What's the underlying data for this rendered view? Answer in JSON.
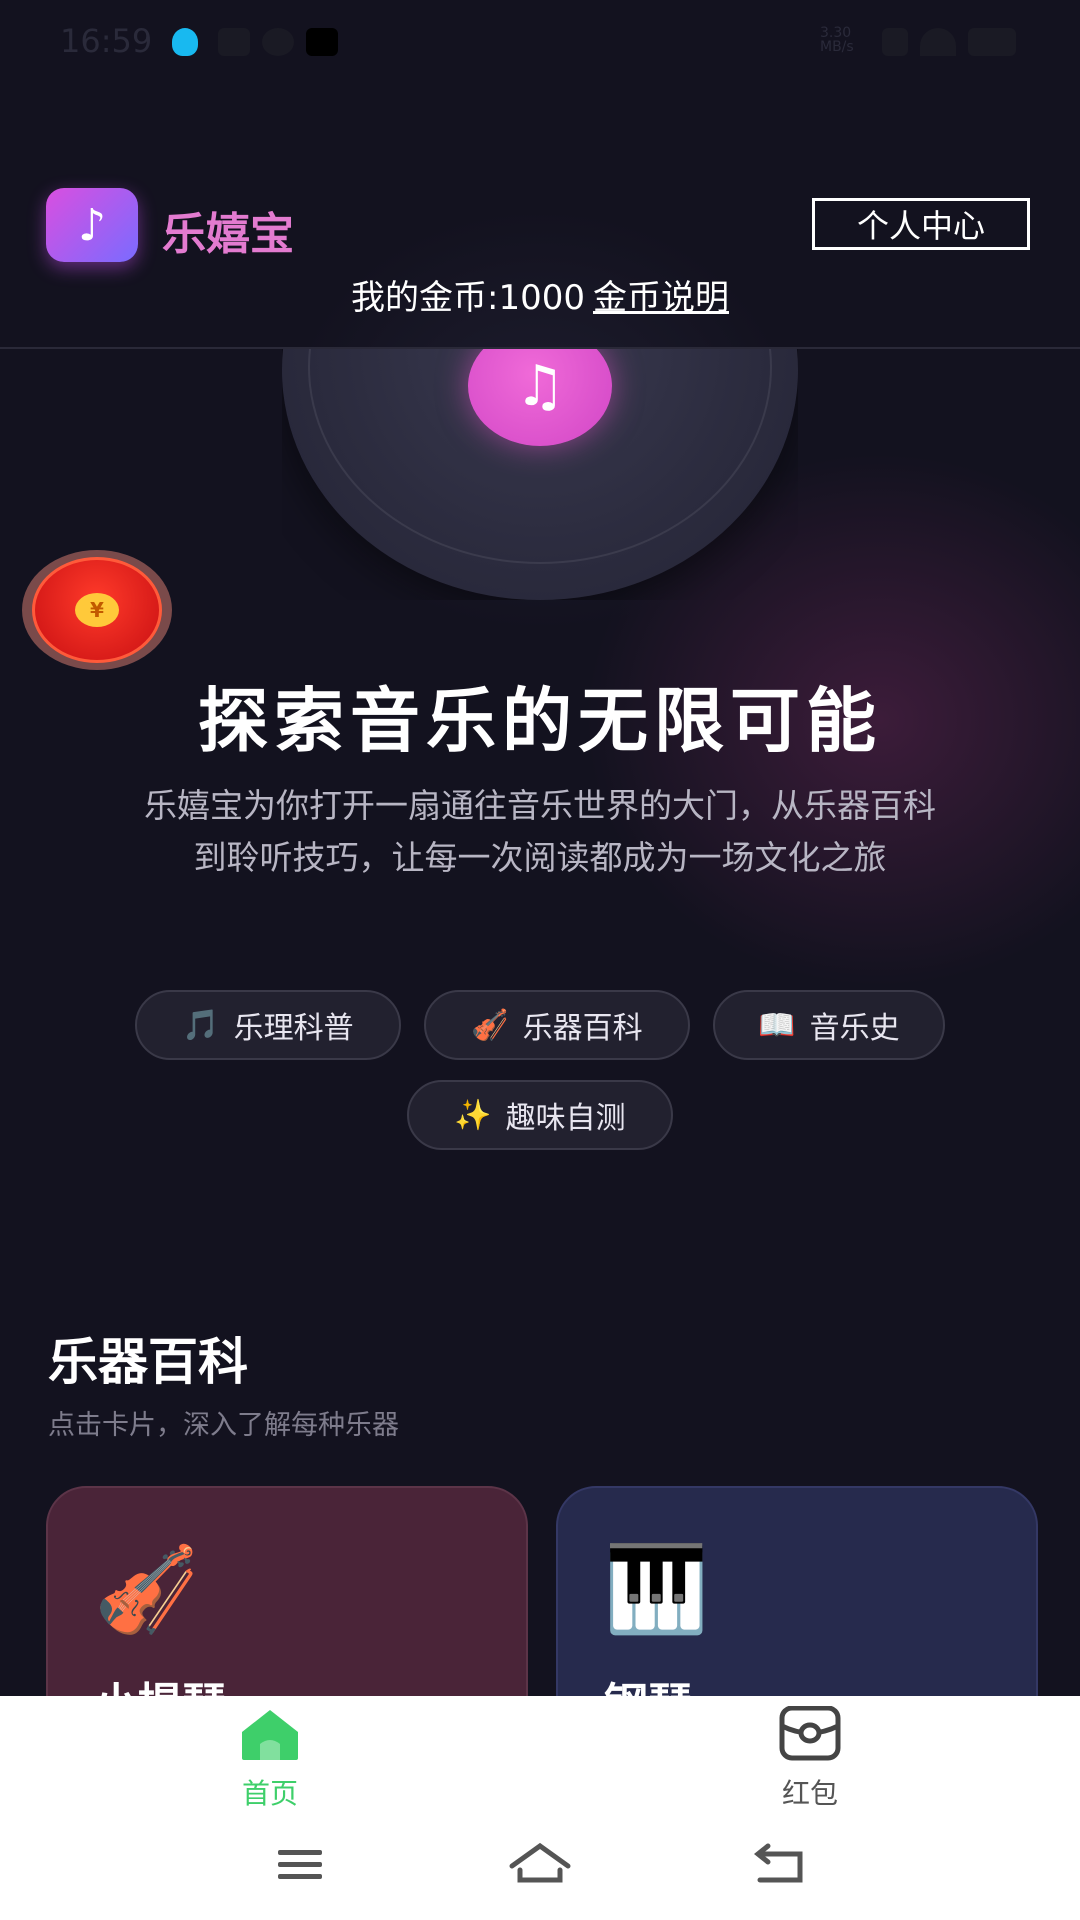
{
  "status_bar": {
    "time": "16:59",
    "speed": "3.30 MB/s",
    "icons": [
      "qq-icon",
      "mail-icon",
      "link-icon",
      "tiktok-icon"
    ]
  },
  "header": {
    "logo_icon": "music-note-icon",
    "app_name": "乐嬉宝",
    "profile_button": "个人中心",
    "coins_text": "我的金币:1000",
    "coins_link": "金币说明"
  },
  "hero": {
    "title": "探索音乐的无限可能",
    "description": "乐嬉宝为你打开一扇通往音乐世界的大门，从乐器百科到聆听技巧，让每一次阅读都成为一场文化之旅",
    "chips": [
      {
        "icon": "🎵",
        "label": "乐理科普"
      },
      {
        "icon": "🎻",
        "label": "乐器百科"
      },
      {
        "icon": "📖",
        "label": "音乐史"
      },
      {
        "icon": "✨",
        "label": "趣味自测"
      }
    ]
  },
  "red_packet": {
    "coin_symbol": "¥"
  },
  "section": {
    "title": "乐器百科",
    "subtitle": "点击卡片，深入了解每种乐器",
    "cards": [
      {
        "icon": "🎻",
        "name": "小提琴"
      },
      {
        "icon": "🎹",
        "name": "钢琴"
      }
    ]
  },
  "tabbar": {
    "tabs": [
      {
        "label": "首页",
        "active": true
      },
      {
        "label": "红包",
        "active": false
      }
    ]
  },
  "colors": {
    "background": "#13121f",
    "accent_pink": "#e37bd0",
    "tab_active": "#3ecf6a"
  }
}
